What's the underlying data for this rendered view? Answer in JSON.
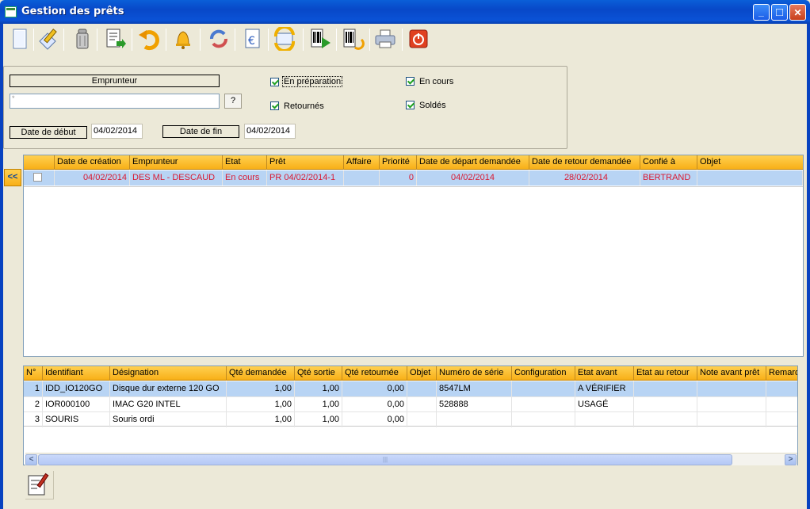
{
  "window": {
    "title": "Gestion des prêts",
    "minimize": "_",
    "maximize": "□",
    "close": "✕"
  },
  "toolbar": [
    {
      "name": "new-document-icon"
    },
    {
      "name": "edit-icon"
    },
    {
      "name": "trash-icon"
    },
    {
      "name": "export-document-icon"
    },
    {
      "name": "undo-icon"
    },
    {
      "name": "bell-icon"
    },
    {
      "name": "refresh-icon"
    },
    {
      "name": "euro-document-icon"
    },
    {
      "name": "sync-icon"
    },
    {
      "name": "barcode-play-icon"
    },
    {
      "name": "barcode-return-icon"
    },
    {
      "name": "printer-icon"
    },
    {
      "name": "power-icon"
    }
  ],
  "filter": {
    "emprunteur_label": "Emprunteur",
    "emprunteur_value": "",
    "emprunteur_hint": "*",
    "lookup_button": "?",
    "date_debut_label": "Date de début",
    "date_debut_value": "04/02/2014",
    "date_fin_label": "Date de fin",
    "date_fin_value": "04/02/2014",
    "checkboxes": [
      {
        "label": "En préparation",
        "checked": true
      },
      {
        "label": "Retournés",
        "checked": true
      },
      {
        "label": "En cours",
        "checked": true
      },
      {
        "label": "Soldés",
        "checked": true
      }
    ]
  },
  "collapse_button": "<<",
  "loans": {
    "columns": [
      "",
      "Date de création",
      "Emprunteur",
      "Etat",
      "Prêt",
      "Affaire",
      "Priorité",
      "Date de départ demandée",
      "Date de retour demandée",
      "Confié à",
      "Objet"
    ],
    "rows": [
      [
        "",
        "04/02/2014",
        "DES ML - DESCAUD",
        "En cours",
        "PR 04/02/2014-1",
        "",
        "0",
        "04/02/2014",
        "28/02/2014",
        "BERTRAND",
        ""
      ]
    ]
  },
  "items": {
    "columns": [
      "N°",
      "Identifiant",
      "Désignation",
      "Qté demandée",
      "Qté sortie",
      "Qté retournée",
      "Objet",
      "Numéro de série",
      "Configuration",
      "Etat avant",
      "Etat au retour",
      "Note avant prêt",
      "Remarq"
    ],
    "rows": [
      [
        "1",
        "IDD_IO120GO",
        "Disque dur externe 120 GO",
        "1,00",
        "1,00",
        "0,00",
        "",
        "8547LM",
        "",
        "A VÉRIFIER",
        "",
        "",
        ""
      ],
      [
        "2",
        "IOR000100",
        "IMAC G20 INTEL",
        "1,00",
        "1,00",
        "0,00",
        "",
        "528888",
        "",
        "USAGÉ",
        "",
        "",
        ""
      ],
      [
        "3",
        "SOURIS",
        "Souris ordi",
        "1,00",
        "1,00",
        "0,00",
        "",
        "",
        "",
        "",
        "",
        "",
        ""
      ]
    ]
  },
  "scrollbar": {
    "left": "<",
    "right": ">",
    "grip": "|||"
  },
  "bottom_action": {
    "name": "edit-list-icon"
  }
}
